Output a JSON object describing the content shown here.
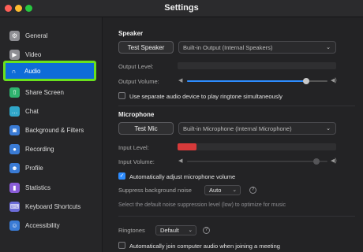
{
  "window": {
    "title": "Settings"
  },
  "sidebar": {
    "items": [
      {
        "label": "General",
        "icon": "gear-icon",
        "color": "#8e8e93",
        "glyph": "⚙"
      },
      {
        "label": "Video",
        "icon": "video-camera-icon",
        "color": "#8e8e93",
        "glyph": "▶"
      },
      {
        "label": "Audio",
        "icon": "headphones-icon",
        "color": "#0e6cd8",
        "glyph": "∩",
        "active": true
      },
      {
        "label": "Share Screen",
        "icon": "share-screen-icon",
        "color": "#2fb36e",
        "glyph": "⇧"
      },
      {
        "label": "Chat",
        "icon": "chat-bubble-icon",
        "color": "#30a6c9",
        "glyph": "…"
      },
      {
        "label": "Background & Filters",
        "icon": "person-icon",
        "color": "#3a7bd5",
        "glyph": "◙"
      },
      {
        "label": "Recording",
        "icon": "record-icon",
        "color": "#3a7bd5",
        "glyph": "●"
      },
      {
        "label": "Profile",
        "icon": "profile-icon",
        "color": "#3a7bd5",
        "glyph": "☻"
      },
      {
        "label": "Statistics",
        "icon": "statistics-icon",
        "color": "#8a5cd8",
        "glyph": "▮"
      },
      {
        "label": "Keyboard Shortcuts",
        "icon": "keyboard-icon",
        "color": "#6c6cd8",
        "glyph": "⌨"
      },
      {
        "label": "Accessibility",
        "icon": "accessibility-icon",
        "color": "#3a7bd5",
        "glyph": "☺"
      }
    ]
  },
  "speaker": {
    "title": "Speaker",
    "test_label": "Test Speaker",
    "device": "Built-in Output (Internal Speakers)",
    "output_level_label": "Output Level:",
    "output_volume_label": "Output Volume:",
    "output_volume": 0.85,
    "separate_device_label": "Use separate audio device to play ringtone simultaneously",
    "separate_device_checked": false
  },
  "microphone": {
    "title": "Microphone",
    "test_label": "Test Mic",
    "device": "Built-in Microphone (Internal Microphone)",
    "input_level_label": "Input Level:",
    "input_level": 0.12,
    "input_volume_label": "Input Volume:",
    "auto_adjust_label": "Automatically adjust microphone volume",
    "auto_adjust_checked": true,
    "suppress_label": "Suppress background noise",
    "suppress_value": "Auto",
    "suppress_hint": "Select the default noise suppression level (low) to optimize for music"
  },
  "ringtones": {
    "label": "Ringtones",
    "value": "Default"
  },
  "auto_join": {
    "label": "Automatically join computer audio when joining a meeting",
    "checked": false
  },
  "colors": {
    "accent": "#2d8cff",
    "active_nav": "#0e6cd8",
    "highlight_border": "#6ae01d",
    "level_meter": "#d63a3a"
  }
}
